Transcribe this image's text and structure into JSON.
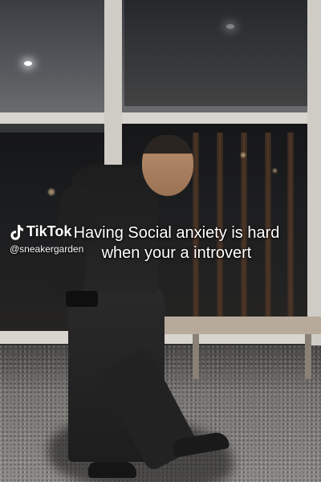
{
  "watermark": {
    "brand": "TikTok",
    "icon": "tiktok-logo-icon",
    "handle": "@sneakergarden"
  },
  "caption": {
    "line1": "Having Social anxiety is hard",
    "line2": "when your a introvert"
  }
}
